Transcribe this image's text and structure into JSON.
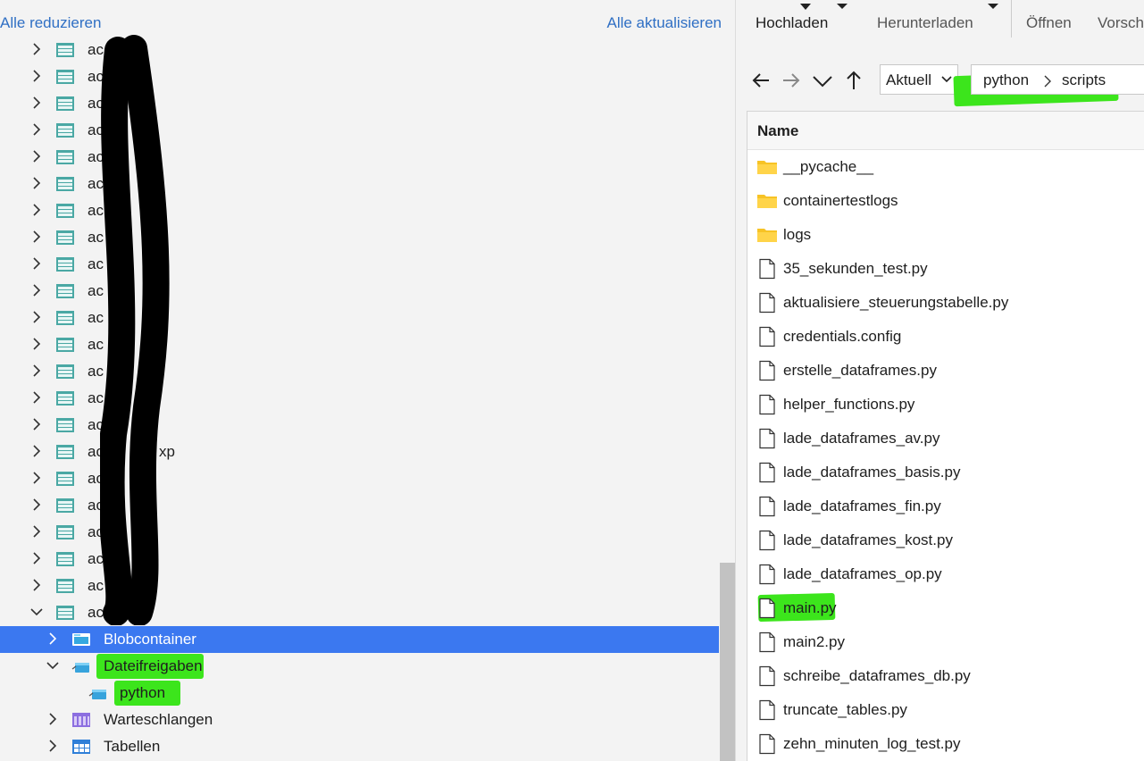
{
  "colors": {
    "accent": "#2f6fc4",
    "selection": "#3b78f0",
    "highlight": "#3ce51c",
    "folder": "#f7c325"
  },
  "explorer": {
    "collapse_all": "Alle reduzieren",
    "refresh_all": "Alle aktualisieren",
    "accounts": [
      {
        "label": "ac"
      },
      {
        "label": "ac"
      },
      {
        "label": "ac"
      },
      {
        "label": "ac"
      },
      {
        "label": "ac"
      },
      {
        "label": "ac"
      },
      {
        "label": "ac"
      },
      {
        "label": "ac"
      },
      {
        "label": "ac"
      },
      {
        "label": "ac"
      },
      {
        "label": "ac"
      },
      {
        "label": "ac"
      },
      {
        "label": "ac"
      },
      {
        "label": "ac"
      },
      {
        "label": "ac"
      },
      {
        "label": "ac"
      },
      {
        "label": "ac"
      },
      {
        "label": "ac"
      },
      {
        "label": "ac"
      },
      {
        "label": "ac"
      },
      {
        "label": "ac"
      },
      {
        "label": "ac"
      }
    ],
    "account_partial_suffix": "xp",
    "children": {
      "blob": "Blobcontainer",
      "files": "Dateifreigaben",
      "share": "python",
      "queues": "Warteschlangen",
      "tables": "Tabellen"
    }
  },
  "toolbar": {
    "upload": "Hochladen",
    "download": "Herunterladen",
    "open": "Öffnen",
    "preview": "Vorsch"
  },
  "nav": {
    "view_select": "Aktuell",
    "path": [
      "python",
      "scripts"
    ]
  },
  "filelist": {
    "header": "Name",
    "items": [
      {
        "name": "__pycache__",
        "type": "folder"
      },
      {
        "name": "containertestlogs",
        "type": "folder"
      },
      {
        "name": "logs",
        "type": "folder"
      },
      {
        "name": "35_sekunden_test.py",
        "type": "file"
      },
      {
        "name": "aktualisiere_steuerungstabelle.py",
        "type": "file"
      },
      {
        "name": "credentials.config",
        "type": "file"
      },
      {
        "name": "erstelle_dataframes.py",
        "type": "file"
      },
      {
        "name": "helper_functions.py",
        "type": "file"
      },
      {
        "name": "lade_dataframes_av.py",
        "type": "file"
      },
      {
        "name": "lade_dataframes_basis.py",
        "type": "file"
      },
      {
        "name": "lade_dataframes_fin.py",
        "type": "file"
      },
      {
        "name": "lade_dataframes_kost.py",
        "type": "file"
      },
      {
        "name": "lade_dataframes_op.py",
        "type": "file"
      },
      {
        "name": "main.py",
        "type": "file"
      },
      {
        "name": "main2.py",
        "type": "file"
      },
      {
        "name": "schreibe_dataframes_db.py",
        "type": "file"
      },
      {
        "name": "truncate_tables.py",
        "type": "file"
      },
      {
        "name": "zehn_minuten_log_test.py",
        "type": "file"
      }
    ]
  }
}
